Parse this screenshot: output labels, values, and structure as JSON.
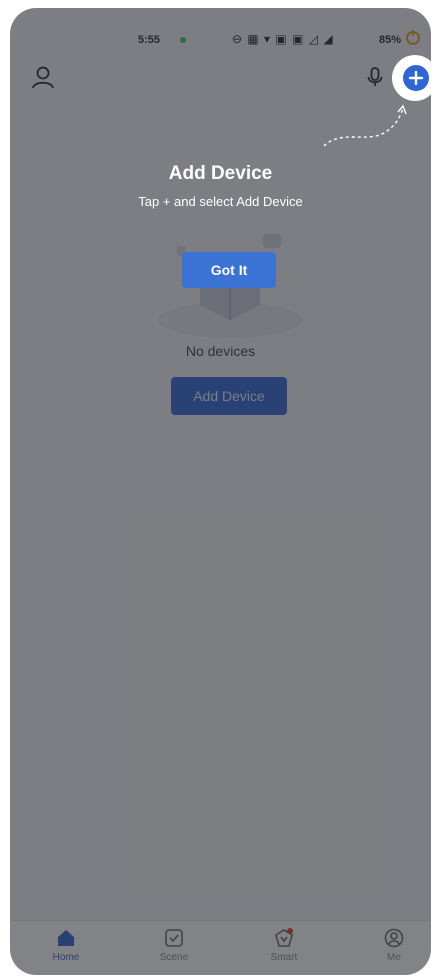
{
  "status_bar": {
    "time": "5:55",
    "icons_text": "⊖ ▦ ▾ ▣ ▣ ◿ ◢",
    "battery": "85%"
  },
  "coach_mark": {
    "title": "Add Device",
    "subtitle": "Tap + and select Add Device",
    "got_it_label": "Got It"
  },
  "empty_state": {
    "message": "No devices",
    "add_device_label": "Add Device"
  },
  "bottom_nav": {
    "items": [
      {
        "label": "Home",
        "icon": "home-icon",
        "active": true
      },
      {
        "label": "Scene",
        "icon": "scene-icon",
        "active": false
      },
      {
        "label": "Smart",
        "icon": "smart-icon",
        "active": false
      },
      {
        "label": "Me",
        "icon": "me-icon",
        "active": false
      }
    ]
  },
  "colors": {
    "accent": "#2f66d6",
    "overlay": "#5b5e64",
    "background": "#f3f4f6"
  }
}
